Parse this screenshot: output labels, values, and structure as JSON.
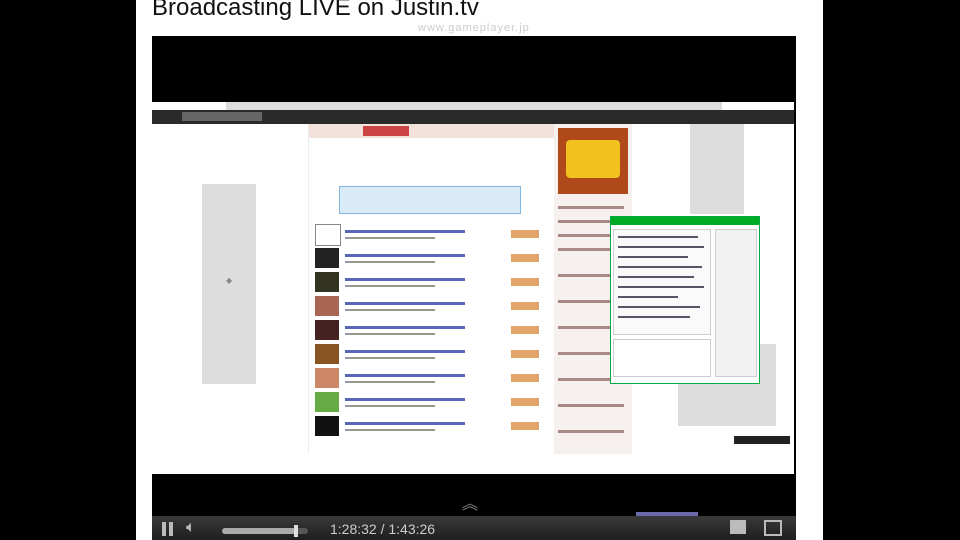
{
  "page": {
    "title": "Broadcasting LIVE on Justin.tv",
    "watermark": "www.gameplayer.jp"
  },
  "player": {
    "time_current": "1:28:32",
    "time_total": "1:43:26",
    "time_display": "1:28:32 / 1:43:26",
    "progress_fraction": 0.856,
    "state": "playing"
  },
  "icons": {
    "pause": "pause-icon",
    "volume": "volume-icon",
    "popout": "popout-icon",
    "fullscreen": "fullscreen-icon",
    "up": "up-arrow-icon"
  },
  "colors": {
    "page_bg": "#ffffff",
    "frame_bg": "#000000",
    "control_bar": "#2b2b2b",
    "chat_accent": "#00aa22"
  }
}
